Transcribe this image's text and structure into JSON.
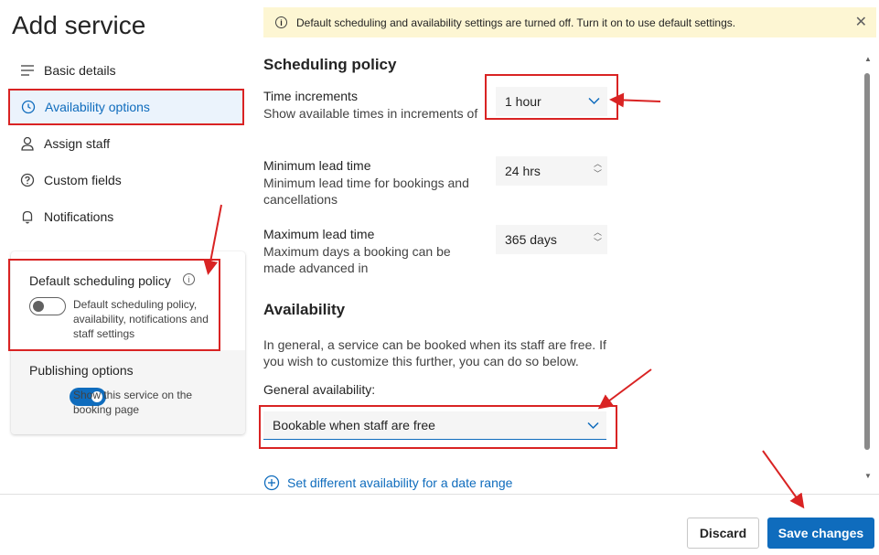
{
  "page": {
    "title": "Add service"
  },
  "nav": {
    "items": [
      {
        "label": "Basic details",
        "icon": "list-icon"
      },
      {
        "label": "Availability options",
        "icon": "clock-icon",
        "active": true
      },
      {
        "label": "Assign staff",
        "icon": "person-icon"
      },
      {
        "label": "Custom fields",
        "icon": "question-circle-icon"
      },
      {
        "label": "Notifications",
        "icon": "bell-icon"
      }
    ]
  },
  "settings_card": {
    "default_policy": {
      "heading": "Default scheduling policy",
      "info_icon": "info-icon",
      "toggle_on": false,
      "description": "Default scheduling policy, availability, notifications and staff settings"
    },
    "publishing": {
      "heading": "Publishing options",
      "toggle_on": true,
      "description": "Show this service on the booking page"
    }
  },
  "banner": {
    "text": "Default scheduling and availability settings are turned off. Turn it on to use default settings.",
    "info_glyph": "i",
    "close_glyph": "✕",
    "color": "#fdf6d3"
  },
  "scheduling": {
    "title": "Scheduling policy",
    "time_increments": {
      "label": "Time increments",
      "description": "Show available times in increments of",
      "value": "1 hour"
    },
    "min_lead": {
      "label": "Minimum lead time",
      "description_line1": "Minimum lead time for bookings and",
      "description_line2": "cancellations",
      "value": "24 hrs"
    },
    "max_lead": {
      "label": "Maximum lead time",
      "description_line1": "Maximum days a booking can be",
      "description_line2": "made advanced in",
      "value": "365 days"
    }
  },
  "availability": {
    "title": "Availability",
    "description_line1": "In general, a service can be booked when its staff are free. If",
    "description_line2": "you wish to customize this further, you can do so below.",
    "general_label": "General availability:",
    "general_value": "Bookable when staff are free",
    "date_range_link": "Set different availability for a date range"
  },
  "footer": {
    "discard_label": "Discard",
    "save_label": "Save changes"
  },
  "colors": {
    "accent": "#0f6cbd",
    "highlight_box": "#d92323",
    "annotation_arrow": "#d92323"
  }
}
